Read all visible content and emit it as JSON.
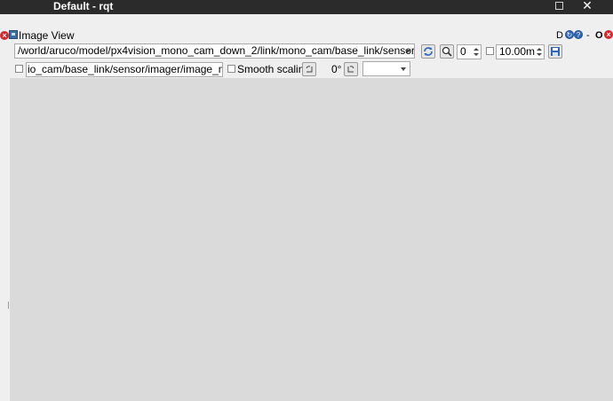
{
  "window": {
    "title": "Default - rqt"
  },
  "plugin": {
    "title": "Image View",
    "header_buttons": {
      "d_label": "D",
      "minimize_label": "-",
      "float_label": "O"
    }
  },
  "toolbar": {
    "topic": "/world/aruco/model/px4vision_mono_cam_down_2/link/mono_cam/base_link/sensor/imager/image",
    "zoom_value": "0",
    "max_value": "10.00m",
    "mouse_topic": "io_cam/base_link/sensor/imager/image_mouse_left",
    "smooth_label": "Smooth scaling",
    "rotation_label": "0°",
    "color_scheme_value": ""
  },
  "colors": {
    "titlebar_bg": "#2b2b2b",
    "canvas_bg": "#dadada",
    "close_red": "#d9242a",
    "help_blue": "#2f67b7"
  }
}
